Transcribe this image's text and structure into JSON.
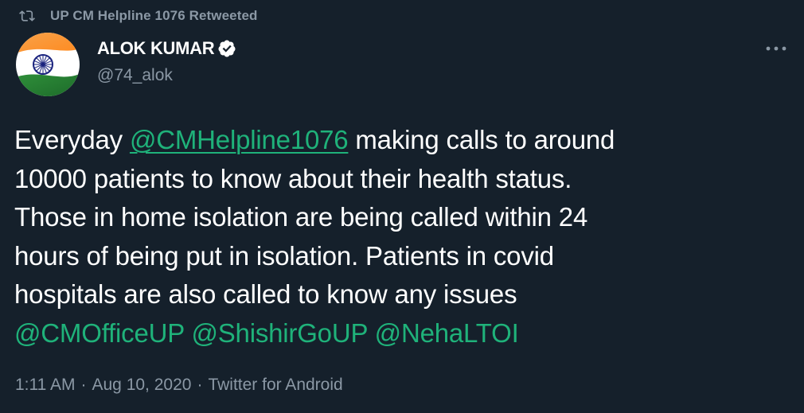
{
  "retweet_banner": {
    "text": "UP CM Helpline 1076 Retweeted",
    "icon": "retweet-icon"
  },
  "author": {
    "display_name": "ALOK KUMAR",
    "handle": "@74_alok",
    "verified": true,
    "avatar_icon": "indian-flag-avatar",
    "more_icon": "more-options-icon"
  },
  "tweet": {
    "line1_prefix": "Everyday ",
    "line1_mention": "@CMHelpline1076",
    "line1_suffix": " making calls to around",
    "line2": "10000 patients to know about their health status.",
    "line3": "Those in home isolation are being called within 24",
    "line4": "hours of being put in isolation. Patients in covid",
    "line5": "hospitals are also called to know any issues",
    "mentions": [
      "@CMOfficeUP",
      "@ShishirGoUP",
      "@NehaLTOI"
    ]
  },
  "meta": {
    "time": "1:11 AM",
    "date": "Aug 10, 2020",
    "source": "Twitter for Android",
    "separator": "·"
  },
  "colors": {
    "background": "#15202b",
    "text": "#ffffff",
    "secondary": "#8b98a5",
    "mention": "#1fb27a"
  }
}
